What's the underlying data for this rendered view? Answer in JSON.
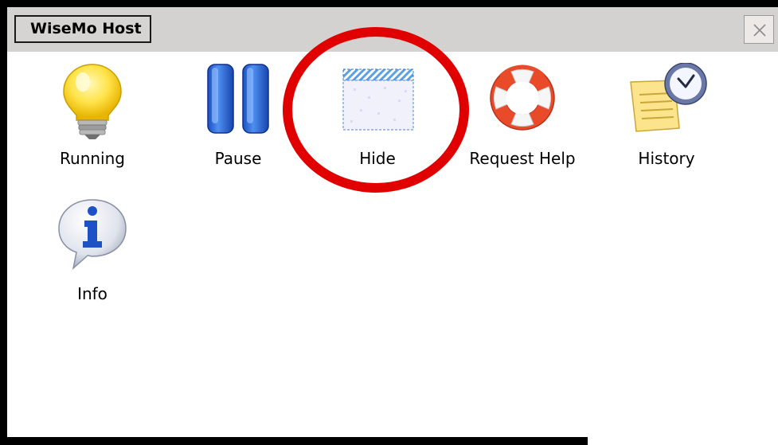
{
  "window": {
    "title": "WiseMo Host",
    "close_glyph": "×"
  },
  "items": [
    {
      "label": "Running",
      "icon": "lightbulb-icon"
    },
    {
      "label": "Pause",
      "icon": "pause-icon"
    },
    {
      "label": "Hide",
      "icon": "hide-window-icon"
    },
    {
      "label": "Request Help",
      "icon": "lifebuoy-icon"
    },
    {
      "label": "History",
      "icon": "history-clock-icon"
    },
    {
      "label": "Info",
      "icon": "info-icon"
    }
  ],
  "annotation": {
    "shape": "circle",
    "color": "#e00000",
    "target": "Hide"
  }
}
